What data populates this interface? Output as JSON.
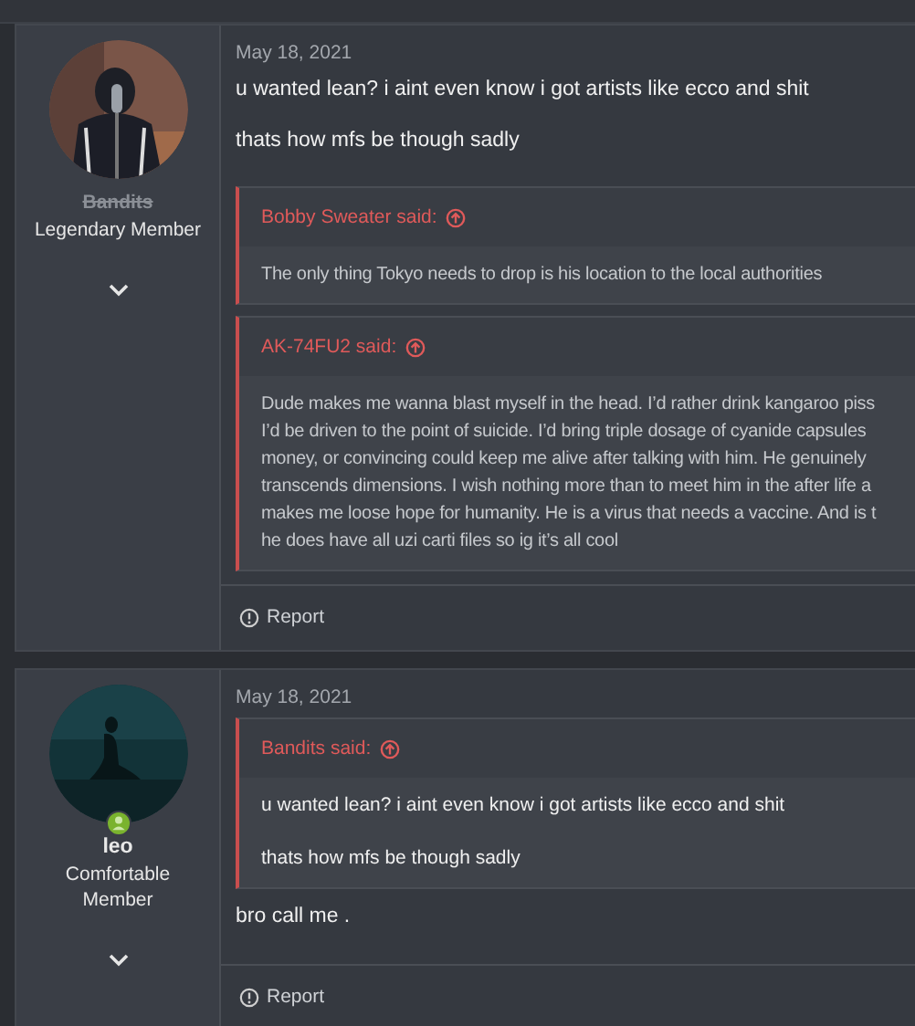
{
  "posts": [
    {
      "author": {
        "name": "Bandits",
        "strikethrough": true,
        "title": "Legendary Member",
        "online": false
      },
      "date": "May 18, 2021",
      "blocks": [
        {
          "kind": "text",
          "lines": [
            "u wanted lean? i aint even know i got artists like ecco and shit",
            "thats how mfs be though sadly"
          ]
        },
        {
          "kind": "quote",
          "source": "Bobby Sweater said:",
          "lines": [
            "The only thing Tokyo needs to drop is his location to the local authorities"
          ],
          "bright": false
        },
        {
          "kind": "quote",
          "source": "AK-74FU2 said:",
          "lines": [
            "Dude makes me wanna blast myself in the head. I’d rather drink kangaroo piss",
            "I’d be driven to the point of suicide. I’d bring triple dosage of cyanide capsules",
            "money, or convincing could keep me alive after talking with him. He genuinely",
            "transcends dimensions. I wish nothing more than to meet him in the after life a",
            "makes me loose hope for humanity. He is a virus that needs a vaccine. And is t",
            "he does have all uzi carti files so ig it’s all cool"
          ],
          "bright": false
        }
      ],
      "actions": [
        "Report"
      ]
    },
    {
      "author": {
        "name": "leo",
        "strikethrough": false,
        "title": "Comfortable Member",
        "online": true
      },
      "date": "May 18, 2021",
      "blocks": [
        {
          "kind": "quote",
          "source": "Bandits said:",
          "lines": [
            "u wanted lean? i aint even know i got artists like ecco and shit",
            "thats how mfs be though sadly"
          ],
          "bright": true
        },
        {
          "kind": "text",
          "lines": [
            "bro call me ."
          ]
        }
      ],
      "actions": [
        "Report"
      ]
    }
  ]
}
